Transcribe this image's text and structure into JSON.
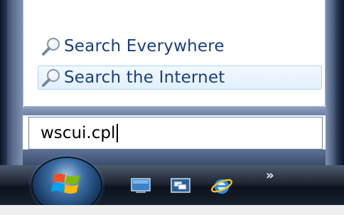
{
  "search_results": {
    "items": [
      {
        "label": "Search Everywhere",
        "icon": "magnifier-icon"
      },
      {
        "label": "Search the Internet",
        "icon": "magnifier-icon",
        "highlighted": true
      }
    ]
  },
  "search": {
    "value": "wscui.cpl"
  },
  "taskbar": {
    "start_button": "windows-logo",
    "quick_launch": [
      {
        "icon": "show-desktop-icon"
      },
      {
        "icon": "switch-windows-icon"
      },
      {
        "icon": "internet-explorer-icon"
      }
    ],
    "overflow_label": "»"
  },
  "colors": {
    "result_text": "#1a3e82",
    "highlight_bg": "#e1f0fc",
    "highlight_border": "#a6d4f5",
    "taskbar_dark": "#16202e"
  }
}
